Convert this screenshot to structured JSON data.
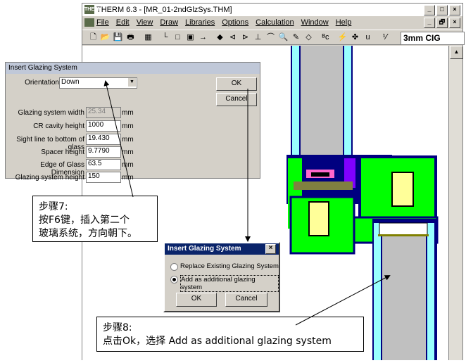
{
  "window": {
    "title": "THERM 6.3 - [MR_01-2ndGlzSys.THM]",
    "app_icon_text": "THERM",
    "controls": [
      "_",
      "□",
      "×"
    ],
    "doc_controls": [
      "_",
      "🗗",
      "×"
    ]
  },
  "menu": [
    "File",
    "Edit",
    "View",
    "Draw",
    "Libraries",
    "Options",
    "Calculation",
    "Window",
    "Help"
  ],
  "toolbar": {
    "glazing_select_value": "3mm CIG"
  },
  "dialog1": {
    "title": "Insert Glazing System",
    "orientation_label": "Orientation",
    "orientation_value": "Down",
    "ok_label": "OK",
    "cancel_label": "Cancel",
    "fields": [
      {
        "label": "Glazing system width",
        "value": "25.34",
        "unit": "mm"
      },
      {
        "label": "CR cavity height",
        "value": "1000",
        "unit": "mm"
      },
      {
        "label": "Sight line to bottom of glass",
        "value": "19.430",
        "unit": "mm"
      },
      {
        "label": "Spacer height",
        "value": "9.7790",
        "unit": "mm"
      },
      {
        "label": "Edge of Glass Dimension",
        "value": "63.5",
        "unit": "mm"
      },
      {
        "label": "Glazing system height",
        "value": "150",
        "unit": "mm"
      }
    ]
  },
  "dialog2": {
    "title": "Insert Glazing System",
    "close": "×",
    "option1": "Replace Existing Glazing System",
    "option2": "Add as additional glazing system",
    "ok_label": "OK",
    "cancel_label": "Cancel"
  },
  "callout1": {
    "line1": "步骤7:",
    "line2": "按F6键，插入第二个",
    "line3": "玻璃系统，方向朝下。"
  },
  "callout2": {
    "line1": "步骤8:",
    "line2": "点击Ok，选择 Add as additional glazing system"
  },
  "colors": {
    "frame_green": "#00ff00",
    "outline_navy": "#000080",
    "insulation_yellow": "#ffff99",
    "glass_cyan": "#99ffff",
    "gray_fill": "#c0c0c0",
    "purple": "#8000ff",
    "pink": "#ff66cc"
  }
}
